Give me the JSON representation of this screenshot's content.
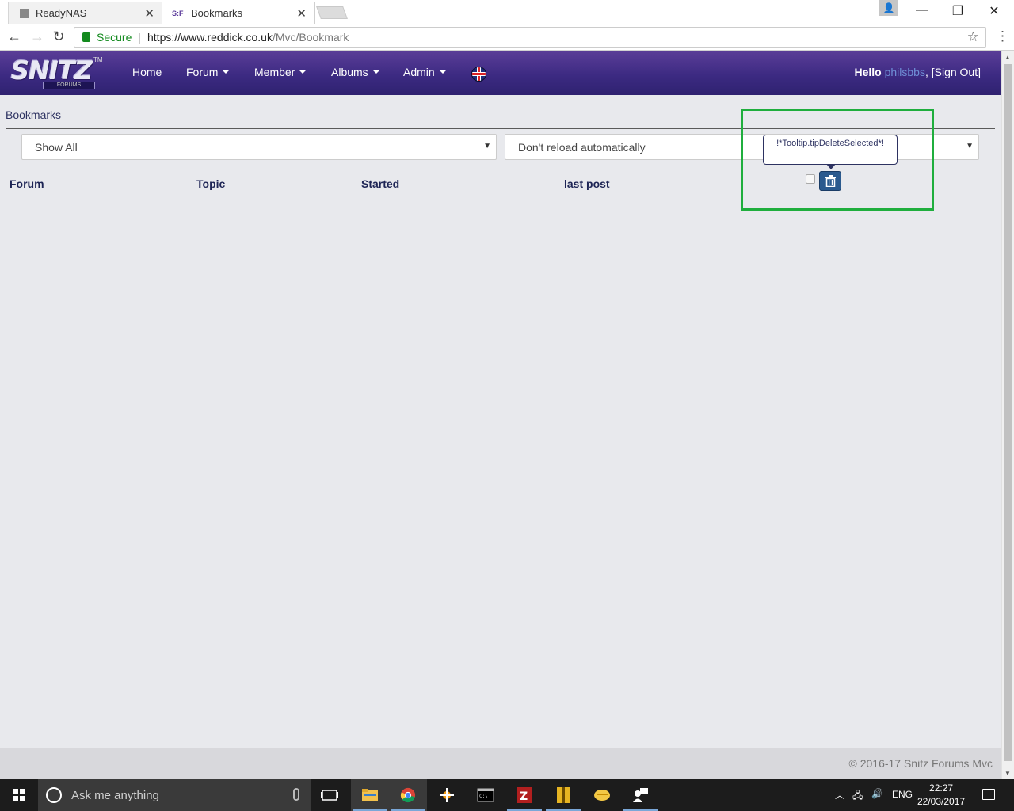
{
  "browser": {
    "tabs": [
      {
        "title": "ReadyNAS"
      },
      {
        "title": "Bookmarks",
        "favicon_text": "S:F"
      }
    ],
    "address": {
      "secure_label": "Secure",
      "url_host": "https://www.reddick.co.uk",
      "url_path": "/Mvc/Bookmark"
    }
  },
  "site": {
    "logo_text": "SNITZ",
    "logo_sub": "FORUMS",
    "logo_tm": "TM",
    "nav": [
      {
        "label": "Home"
      },
      {
        "label": "Forum"
      },
      {
        "label": "Member"
      },
      {
        "label": "Albums"
      },
      {
        "label": "Admin"
      }
    ],
    "greeting": "Hello",
    "username": "philsbbs",
    "signout": ", [Sign Out]"
  },
  "page": {
    "title": "Bookmarks",
    "filter_select": {
      "value": "Show All"
    },
    "reload_select": {
      "value": "Don't reload automatically"
    },
    "columns": [
      "Forum",
      "Topic",
      "Started",
      "last post"
    ],
    "tooltip": "!*Tooltip.tipDeleteSelected*!"
  },
  "footer": {
    "copyright": "© 2016-17 Snitz Forums Mvc"
  },
  "taskbar": {
    "search_placeholder": "Ask me anything",
    "language": "ENG",
    "time": "22:27",
    "date": "22/03/2017"
  },
  "colors": {
    "header": "#3c2a82",
    "highlight": "#1fae3d",
    "delete_button": "#2b5a8e",
    "username": "#6f8fd6"
  }
}
